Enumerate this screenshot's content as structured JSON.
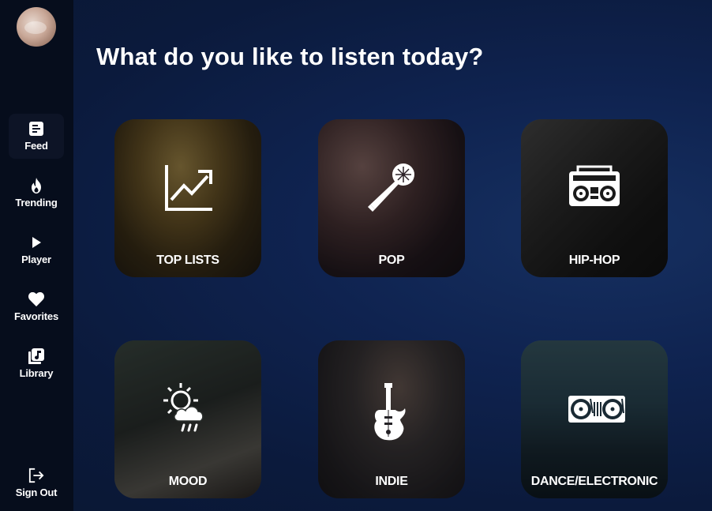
{
  "sidebar": {
    "items": [
      {
        "label": "Feed",
        "icon": "feed-icon",
        "active": true
      },
      {
        "label": "Trending",
        "icon": "flame-icon",
        "active": false
      },
      {
        "label": "Player",
        "icon": "play-icon",
        "active": false
      },
      {
        "label": "Favorites",
        "icon": "heart-icon",
        "active": false
      },
      {
        "label": "Library",
        "icon": "library-icon",
        "active": false
      }
    ],
    "sign_out": {
      "label": "Sign Out",
      "icon": "sign-out-icon"
    }
  },
  "main": {
    "title": "What do you like to listen today?",
    "genres": [
      {
        "label": "TOP LISTS",
        "icon": "trending-chart-icon"
      },
      {
        "label": "POP",
        "icon": "microphone-icon"
      },
      {
        "label": "HIP-HOP",
        "icon": "boombox-icon"
      },
      {
        "label": "MOOD",
        "icon": "weather-icon"
      },
      {
        "label": "INDIE",
        "icon": "electric-guitar-icon"
      },
      {
        "label": "DANCE/ELECTRONIC",
        "icon": "turntables-icon"
      }
    ]
  },
  "colors": {
    "sidebar_bg": "#060d1c",
    "main_bg": "#0f2350",
    "active_item_bg": "#0d1426",
    "text": "#ffffff"
  }
}
